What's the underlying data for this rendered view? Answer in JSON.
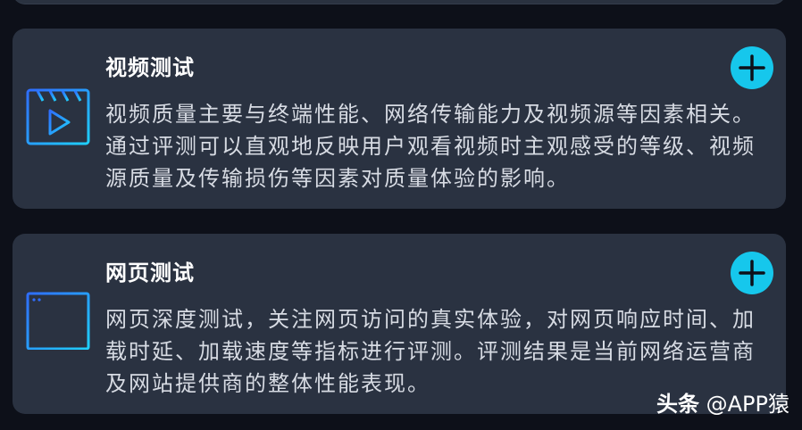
{
  "cards": [
    {
      "title": "视频测试",
      "description": "视频质量主要与终端性能、网络传输能力及视频源等因素相关。通过评测可以直观地反映用户观看视频时主观感受的等级、视频源质量及传输损伤等因素对质量体验的影响。",
      "icon": "video-clapper-icon",
      "action_icon": "plus-icon"
    },
    {
      "title": "网页测试",
      "description": "网页深度测试，关注网页访问的真实体验，对网页响应时间、加载时延、加载速度等指标进行评测。评测结果是当前网络运营商及网站提供商的整体性能表现。",
      "icon": "browser-window-icon",
      "action_icon": "plus-icon"
    }
  ],
  "watermark": {
    "brand": "头条",
    "handle": "@APP猿"
  },
  "colors": {
    "background": "#0d1019",
    "card": "#2a3241",
    "accent": "#16c7ec",
    "icon_gradient_start": "#2f6dff",
    "icon_gradient_end": "#1fd0ff"
  }
}
